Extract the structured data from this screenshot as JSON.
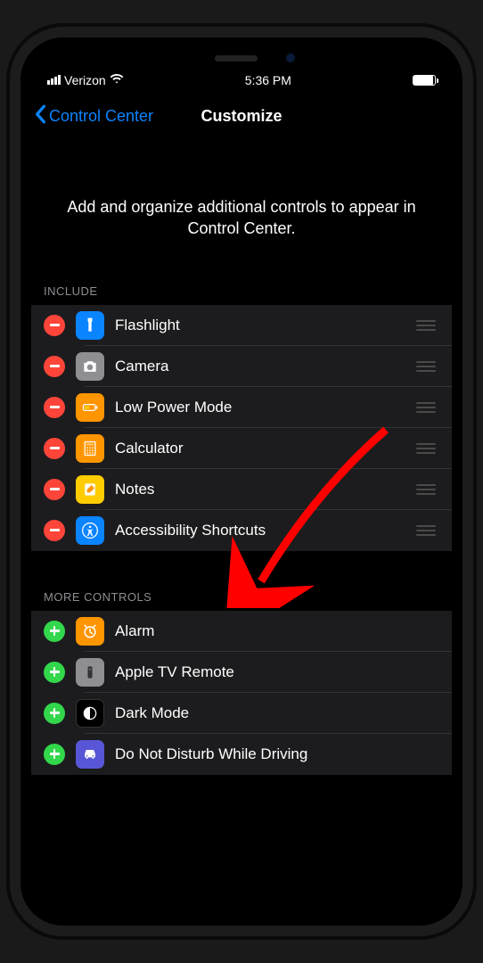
{
  "status_bar": {
    "carrier": "Verizon",
    "time": "5:36 PM"
  },
  "nav": {
    "back_label": "Control Center",
    "title": "Customize"
  },
  "description": "Add and organize additional controls to appear in Control Center.",
  "sections": {
    "include": {
      "header": "INCLUDE",
      "items": [
        {
          "label": "Flashlight",
          "icon": "flashlight-icon",
          "icon_bg": "ic-flashlight"
        },
        {
          "label": "Camera",
          "icon": "camera-icon",
          "icon_bg": "ic-camera"
        },
        {
          "label": "Low Power Mode",
          "icon": "battery-low-icon",
          "icon_bg": "ic-lowpower"
        },
        {
          "label": "Calculator",
          "icon": "calculator-icon",
          "icon_bg": "ic-calculator"
        },
        {
          "label": "Notes",
          "icon": "notes-icon",
          "icon_bg": "ic-notes"
        },
        {
          "label": "Accessibility Shortcuts",
          "icon": "accessibility-icon",
          "icon_bg": "ic-accessibility"
        }
      ]
    },
    "more": {
      "header": "MORE CONTROLS",
      "items": [
        {
          "label": "Alarm",
          "icon": "alarm-icon",
          "icon_bg": "ic-alarm"
        },
        {
          "label": "Apple TV Remote",
          "icon": "remote-icon",
          "icon_bg": "ic-appletv"
        },
        {
          "label": "Dark Mode",
          "icon": "darkmode-icon",
          "icon_bg": "ic-darkmode"
        },
        {
          "label": "Do Not Disturb While Driving",
          "icon": "car-icon",
          "icon_bg": "ic-dnd"
        }
      ]
    }
  },
  "annotation": {
    "arrow_color": "#ff0000",
    "target_item": "Accessibility Shortcuts"
  }
}
